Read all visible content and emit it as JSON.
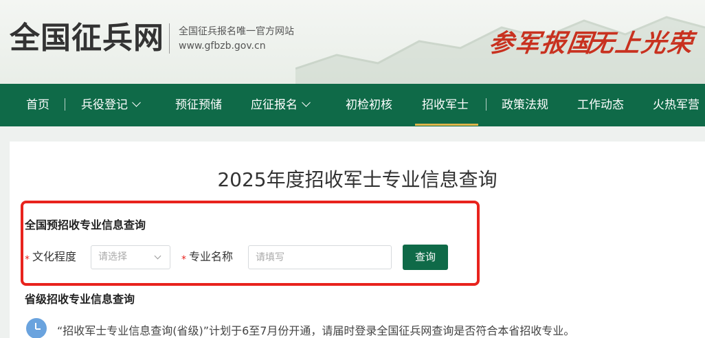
{
  "header": {
    "logo_text": "全国征兵网",
    "tagline": "全国征兵报名唯一官方网站",
    "url": "www.gfbzb.gov.cn",
    "slogan_1": "参军报国",
    "slogan_2": "无上光荣"
  },
  "nav": {
    "items": [
      {
        "label": "首页"
      },
      {
        "label": "兵役登记"
      },
      {
        "label": "预征预储"
      },
      {
        "label": "应征报名"
      },
      {
        "label": "初检初核"
      },
      {
        "label": "招收军士"
      },
      {
        "label": "政策法规"
      },
      {
        "label": "工作动态"
      },
      {
        "label": "火热军营"
      }
    ],
    "active": "招收军士"
  },
  "main": {
    "title": "2025年度招收军士专业信息查询",
    "national_section_title": "全国预招收专业信息查询",
    "form": {
      "required_mark": "*",
      "education_label": "文化程度",
      "education_placeholder": "请选择",
      "major_label": "专业名称",
      "major_placeholder": "请填写",
      "query_button": "查询"
    },
    "provincial_section_title": "省级招收专业信息查询",
    "notice": "“招收军士专业信息查询(省级)”计划于6至7月份开通，请届时登录全国征兵网查询是否符合本省招收专业。"
  },
  "colors": {
    "nav_bg": "#0f6a48",
    "active_underline": "#e0b54a",
    "highlight_box": "#e8231d",
    "slogan": "#c8311f",
    "button_bg": "#0f6a48",
    "notice_icon": "#6aa3de"
  },
  "icons": [
    "chevron-down-icon",
    "clock-icon"
  ]
}
